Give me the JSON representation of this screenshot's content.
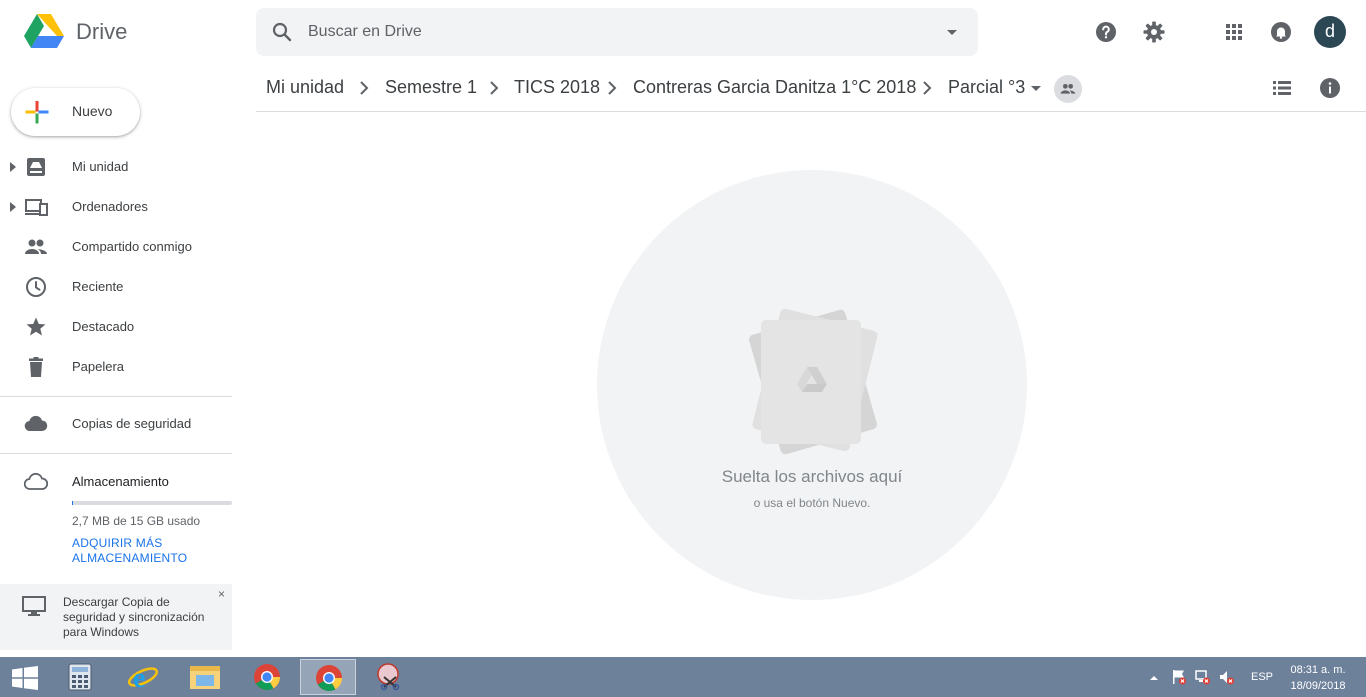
{
  "header": {
    "app_name": "Drive",
    "search_placeholder": "Buscar en Drive",
    "avatar_initial": "d"
  },
  "sidebar": {
    "new_button": "Nuevo",
    "items": [
      {
        "label": "Mi unidad",
        "icon": "my-drive-icon",
        "expandable": true
      },
      {
        "label": "Ordenadores",
        "icon": "computers-icon",
        "expandable": true
      },
      {
        "label": "Compartido conmigo",
        "icon": "shared-icon",
        "expandable": false
      },
      {
        "label": "Reciente",
        "icon": "clock-icon",
        "expandable": false
      },
      {
        "label": "Destacado",
        "icon": "star-icon",
        "expandable": false
      },
      {
        "label": "Papelera",
        "icon": "trash-icon",
        "expandable": false
      }
    ],
    "backups": "Copias de seguridad",
    "storage": {
      "label": "Almacenamiento",
      "used": "2,7 MB de 15 GB usado",
      "used_fraction": 0.0002,
      "buy_link": "ADQUIRIR MÁS ALMACENAMIENTO"
    },
    "promo": {
      "text": "Descargar Copia de seguridad y sincronización para Windows",
      "close": "×"
    }
  },
  "breadcrumb": {
    "items": [
      "Mi unidad",
      "Semestre 1",
      "TICS 2018",
      "Contreras Garcia Danitza 1°C 2018",
      "Parcial °3"
    ]
  },
  "empty_state": {
    "title": "Suelta los archivos aquí",
    "subtitle": "o usa el botón Nuevo."
  },
  "taskbar": {
    "apps": [
      "windows-start",
      "calculator",
      "internet-explorer",
      "file-explorer",
      "chrome",
      "chrome",
      "snipping-tool"
    ],
    "active_index": 5,
    "language": "ESP",
    "time": "08:31 a. m.",
    "date": "18/09/2018"
  },
  "colors": {
    "accent_blue": "#1a73e8",
    "icon_gray": "#5f6368",
    "avatar_bg": "#2d4855",
    "taskbar_bg": "#6e819b"
  }
}
